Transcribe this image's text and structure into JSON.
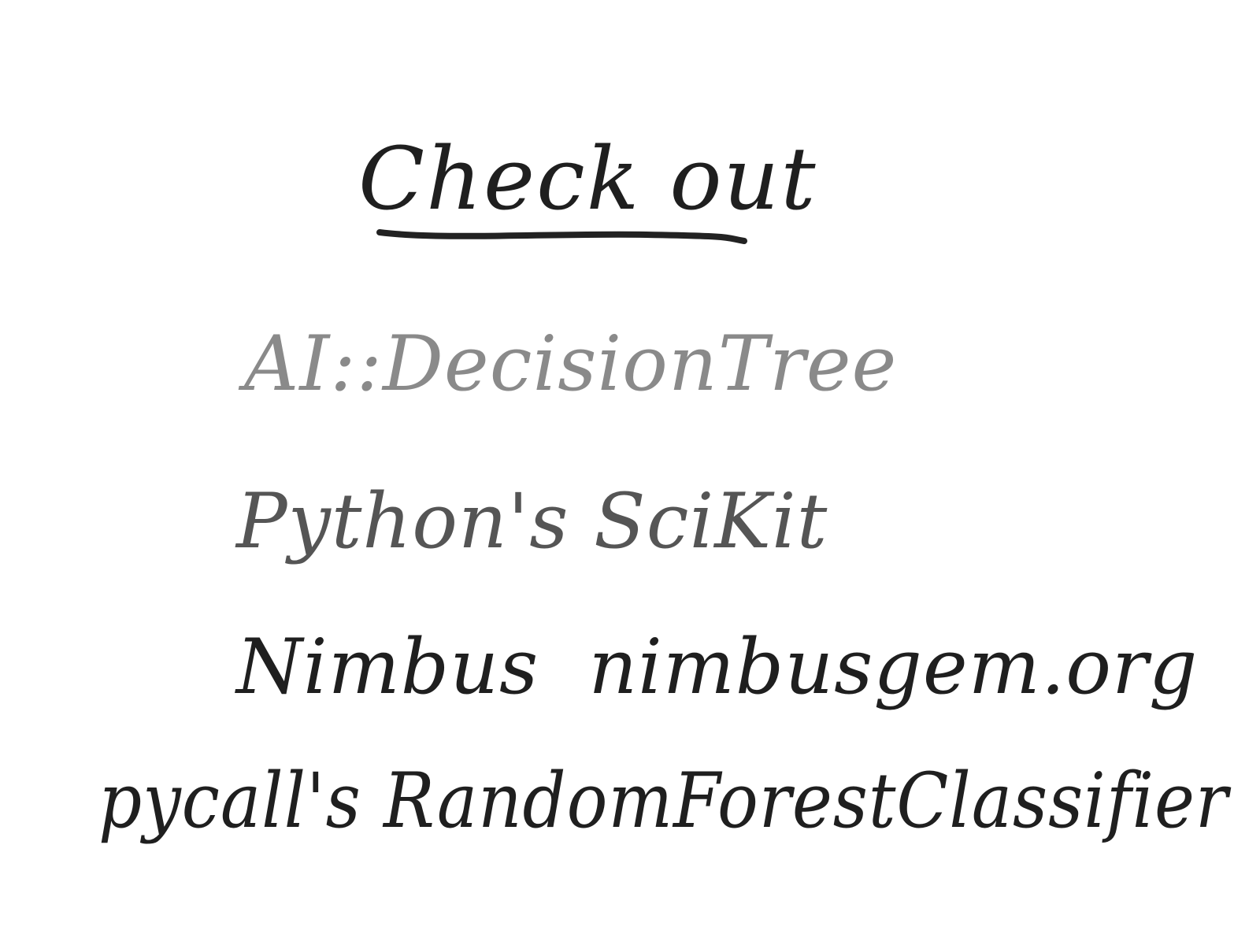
{
  "note": {
    "title": "Check out",
    "lines": [
      "AI::DecisionTree",
      "Python's SciKit",
      "Nimbus  nimbusgem.org",
      "pycall's RandomForestClassifier"
    ]
  },
  "colors": {
    "ink": "#222222",
    "faded_ink": "#8a8a8a",
    "background": "#ffffff"
  }
}
